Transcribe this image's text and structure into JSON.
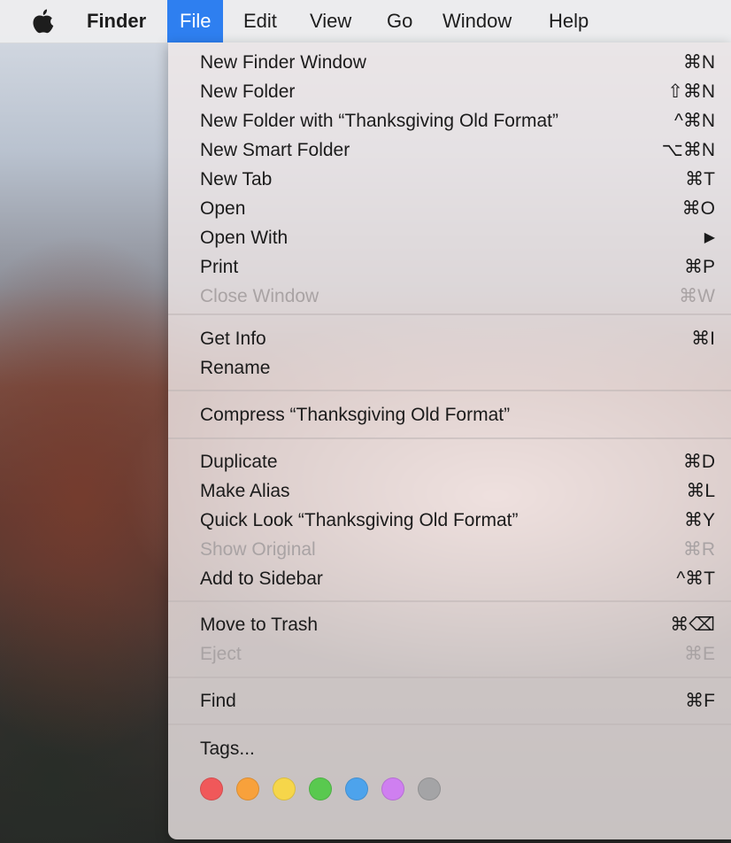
{
  "menubar": {
    "apple_icon": "apple-icon",
    "app": "Finder",
    "items": [
      "File",
      "Edit",
      "View",
      "Go",
      "Window",
      "Help"
    ],
    "active": "File",
    "active_color": "#2e7ff0"
  },
  "menu": {
    "groups": [
      [
        {
          "label": "New Finder Window",
          "shortcut": "⌘N",
          "enabled": true
        },
        {
          "label": "New Folder",
          "shortcut": "⇧⌘N",
          "enabled": true
        },
        {
          "label": "New Folder with “Thanksgiving Old Format”",
          "shortcut": "^⌘N",
          "enabled": true
        },
        {
          "label": "New Smart Folder",
          "shortcut": "⌥⌘N",
          "enabled": true
        },
        {
          "label": "New Tab",
          "shortcut": "⌘T",
          "enabled": true
        },
        {
          "label": "Open",
          "shortcut": "⌘O",
          "enabled": true
        },
        {
          "label": "Open With",
          "shortcut": "▶",
          "enabled": true
        },
        {
          "label": "Print",
          "shortcut": "⌘P",
          "enabled": true
        },
        {
          "label": "Close Window",
          "shortcut": "⌘W",
          "enabled": false
        }
      ],
      [
        {
          "label": "Get Info",
          "shortcut": "⌘I",
          "enabled": true
        },
        {
          "label": "Rename",
          "shortcut": "",
          "enabled": true
        }
      ],
      [
        {
          "label": "Compress “Thanksgiving Old Format”",
          "shortcut": "",
          "enabled": true
        }
      ],
      [
        {
          "label": "Duplicate",
          "shortcut": "⌘D",
          "enabled": true
        },
        {
          "label": "Make Alias",
          "shortcut": "⌘L",
          "enabled": true
        },
        {
          "label": "Quick Look “Thanksgiving Old Format”",
          "shortcut": "⌘Y",
          "enabled": true
        },
        {
          "label": "Show Original",
          "shortcut": "⌘R",
          "enabled": false
        },
        {
          "label": "Add to Sidebar",
          "shortcut": "^⌘T",
          "enabled": true
        }
      ],
      [
        {
          "label": "Move to Trash",
          "shortcut": "⌘⌫",
          "enabled": true
        },
        {
          "label": "Eject",
          "shortcut": "⌘E",
          "enabled": false
        }
      ],
      [
        {
          "label": "Find",
          "shortcut": "⌘F",
          "enabled": true
        }
      ],
      [
        {
          "label": "Tags...",
          "shortcut": "",
          "enabled": true
        }
      ]
    ],
    "tag_colors": [
      {
        "name": "red",
        "color": "#f0585a"
      },
      {
        "name": "orange",
        "color": "#f8a13b"
      },
      {
        "name": "yellow",
        "color": "#f6d64a"
      },
      {
        "name": "green",
        "color": "#59c94f"
      },
      {
        "name": "blue",
        "color": "#4da3ec"
      },
      {
        "name": "purple",
        "color": "#cf7ff0"
      },
      {
        "name": "gray",
        "color": "#a4a4a6"
      }
    ]
  }
}
